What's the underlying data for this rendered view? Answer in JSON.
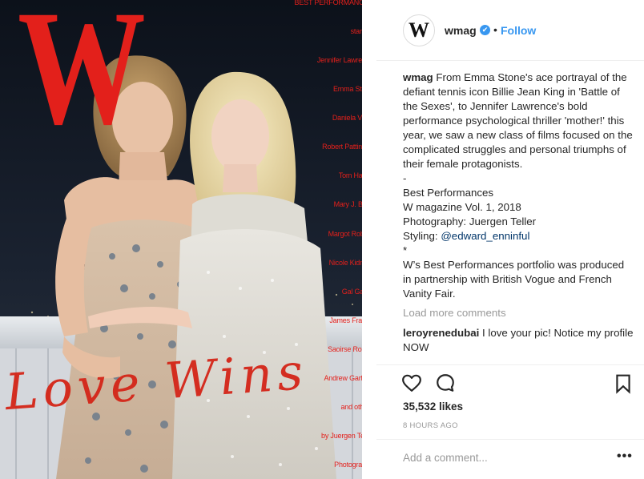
{
  "cover": {
    "logo": "W",
    "credits": [
      "BEST PERFORMANCES",
      "starring",
      "Jennifer Lawrence",
      "Emma Stone",
      "Daniela Vega",
      "Robert Pattinson",
      "Tom Hanks",
      "Mary J. Blige",
      "Margot Robbie",
      "Nicole Kidman",
      "Gal Gadot",
      "James Franco",
      "Saoirse Ronan",
      "Andrew Garfield",
      "and others",
      "by Juergen Teller",
      "Photographs"
    ],
    "handwriting": "Love Wins"
  },
  "post": {
    "username": "wmag",
    "verified_glyph": "✔",
    "separator": "•",
    "follow_label": "Follow",
    "avatar_letter": "W",
    "caption_user": "wmag",
    "caption_lines": [
      "From Emma Stone's ace portrayal of the defiant tennis icon Billie Jean King in 'Battle of the Sexes', to Jennifer Lawrence's bold performance psychological thriller 'mother!' this year, we saw a new class of films focused on the complicated struggles and personal triumphs of their female protagonists.",
      "-",
      "Best Performances",
      "W magazine Vol. 1, 2018",
      "Photography: Juergen Teller"
    ],
    "styling_prefix": "Styling: ",
    "styling_mention": "@edward_enninful",
    "caption_after": [
      "*",
      "W’s Best Performances portfolio was produced in partnership with British Vogue and French Vanity Fair."
    ],
    "load_more": "Load more comments",
    "comment_user": "leroyrenedubai",
    "comment_text": "I love your pic! Notice my profile NOW",
    "likes": "35,532 likes",
    "timestamp": "8 HOURS AGO",
    "comment_placeholder": "Add a comment...",
    "more_label": "•••"
  },
  "colors": {
    "accent": "#3897f0",
    "cover_red": "#e3201b",
    "muted": "#999999",
    "mention": "#003569"
  },
  "icons": [
    "heart-icon",
    "comment-icon",
    "bookmark-icon",
    "verified-badge-icon"
  ]
}
